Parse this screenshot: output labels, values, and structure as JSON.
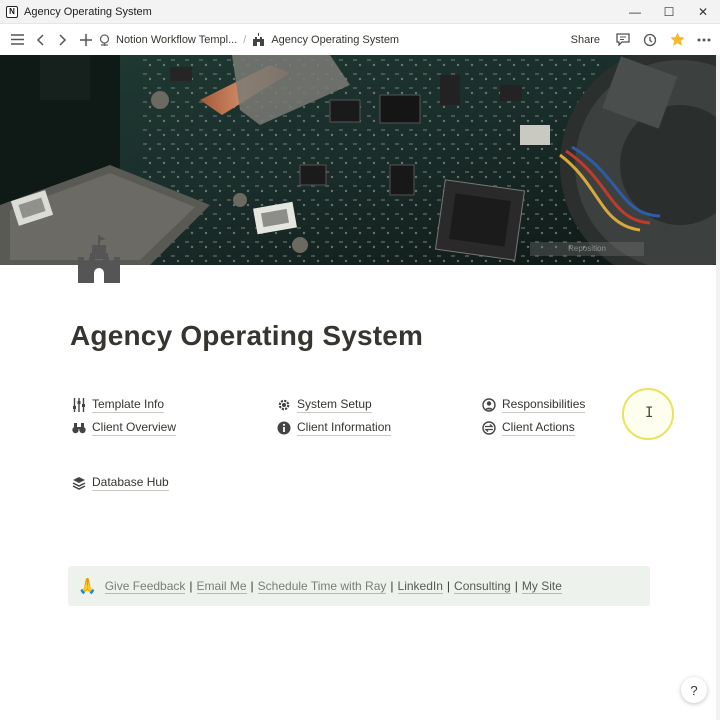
{
  "window": {
    "title": "Agency Operating System",
    "logo_letter": "N",
    "minimize": "—",
    "maximize": "☐",
    "close": "✕"
  },
  "toolbar": {
    "breadcrumbs": [
      {
        "label": "Notion Workflow Templ...",
        "icon": "chip-icon"
      },
      {
        "label": "Agency Operating System",
        "icon": "castle-icon"
      }
    ],
    "separator": "/",
    "share_label": "Share"
  },
  "cover": {
    "caption": "Reposition"
  },
  "page": {
    "title": "Agency Operating System",
    "links": [
      {
        "label": "Template Info",
        "icon": "sliders-icon"
      },
      {
        "label": "System Setup",
        "icon": "gear-icon"
      },
      {
        "label": "Responsibilities",
        "icon": "user-circle-icon"
      },
      {
        "label": "Client Overview",
        "icon": "binoculars-icon"
      },
      {
        "label": "Client Information",
        "icon": "info-icon"
      },
      {
        "label": "Client Actions",
        "icon": "swap-icon"
      },
      {
        "label": "Database Hub",
        "icon": "stack-icon"
      }
    ],
    "callout": {
      "emoji": "🙏",
      "items": [
        {
          "label": "Give Feedback"
        },
        {
          "label": "Email Me"
        },
        {
          "label": "Schedule Time with Ray"
        },
        {
          "label": "LinkedIn"
        },
        {
          "label": "Consulting"
        },
        {
          "label": "My Site"
        }
      ],
      "separator": "|"
    }
  },
  "help_label": "?",
  "colors": {
    "text": "#37352f",
    "callout_bg": "#edf3ec",
    "favorite_star": "#f5b82e",
    "cursor_ring": "#e8e25c"
  }
}
